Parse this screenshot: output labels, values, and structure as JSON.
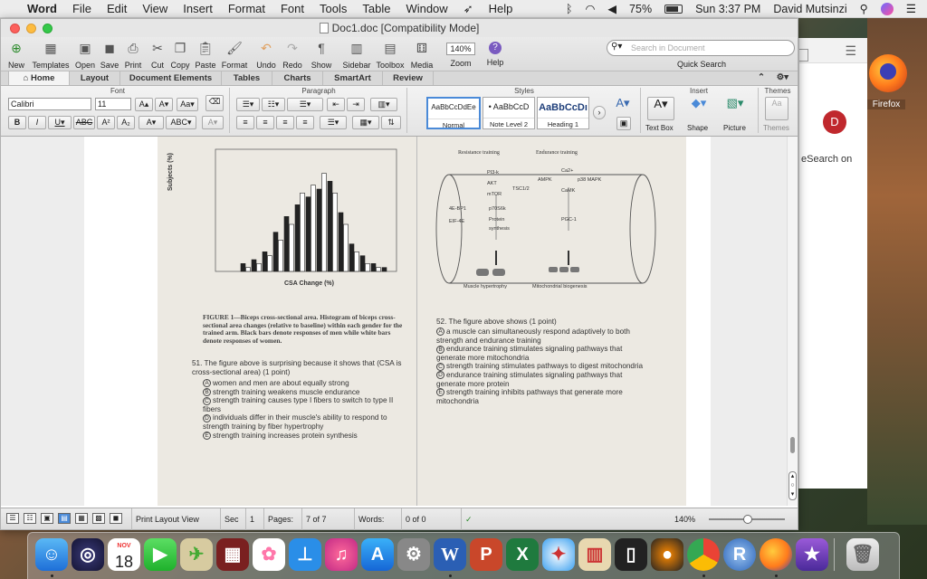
{
  "menubar": {
    "app": "Word",
    "items": [
      "File",
      "Edit",
      "View",
      "Insert",
      "Format",
      "Font",
      "Tools",
      "Table",
      "Window",
      "Help"
    ],
    "battery": "75%",
    "clock": "Sun 3:37 PM",
    "user": "David Mutsinzi"
  },
  "window": {
    "title": "Doc1.doc [Compatibility Mode]"
  },
  "toolbar": {
    "new": "New",
    "templates": "Templates",
    "open": "Open",
    "save": "Save",
    "print": "Print",
    "cut": "Cut",
    "copy": "Copy",
    "paste": "Paste",
    "format": "Format",
    "undo": "Undo",
    "redo": "Redo",
    "show": "Show",
    "sidebar": "Sidebar",
    "toolbox": "Toolbox",
    "media": "Media",
    "zoom_value": "140%",
    "zoom": "Zoom",
    "help": "Help",
    "search_placeholder": "Search in Document",
    "quick_search": "Quick Search"
  },
  "tabs": [
    "Home",
    "Layout",
    "Document Elements",
    "Tables",
    "Charts",
    "SmartArt",
    "Review"
  ],
  "ribbon": {
    "groups": {
      "font": "Font",
      "paragraph": "Paragraph",
      "styles": "Styles",
      "insert": "Insert",
      "themes": "Themes"
    },
    "font_name": "Calibri",
    "font_size": "11",
    "styles": [
      {
        "sample": "AaBbCcDdEe",
        "name": "Normal"
      },
      {
        "sample": "• AaBbCcD",
        "name": "Note Level 2"
      },
      {
        "sample": "AaBbCcDı",
        "name": "Heading 1"
      }
    ],
    "insert": {
      "textbox": "Text Box",
      "shape": "Shape",
      "picture": "Picture",
      "themes": "Themes"
    }
  },
  "document": {
    "chart_header": "CSA Change (%)",
    "figure_caption": "FIGURE 1—Biceps cross-sectional area. Histogram of biceps cross-sectional area changes (relative to baseline) within each gender for the trained arm. Black bars denote responses of men while white bars denote responses of women.",
    "y_axis": "Subjects (%)",
    "q51": {
      "stem": "51. The figure above is surprising because it shows that (CSA is cross-sectional area) (1 point)",
      "options": [
        {
          "letter": "A",
          "text": "women and men are about equally strong"
        },
        {
          "letter": "B",
          "text": "strength training weakens muscle endurance"
        },
        {
          "letter": "C",
          "text": "strength training causes type I fibers to switch to type II fibers"
        },
        {
          "letter": "D",
          "text": "individuals differ in their muscle's ability to respond to strength training by fiber hypertrophy"
        },
        {
          "letter": "E",
          "text": "strength training increases protein synthesis"
        }
      ]
    },
    "q52": {
      "stem": "52. The figure above shows (1 point)",
      "options": [
        {
          "letter": "A",
          "text": "a muscle can simultaneously respond adaptively to both strength and endurance training"
        },
        {
          "letter": "B",
          "text": "endurance training stimulates signaling pathways that generate more mitochondria"
        },
        {
          "letter": "C",
          "text": "strength training stimulates pathways to digest mitochondria"
        },
        {
          "letter": "D",
          "text": "endurance training stimulates signaling pathways that generate more protein"
        },
        {
          "letter": "E",
          "text": "strength training inhibits pathways that generate more mitochondria"
        }
      ]
    },
    "diagram": {
      "resistance": "Resistance training",
      "endurance": "Endurance training",
      "nodes": [
        "PI3-k",
        "AKT",
        "mTOR",
        "TSC1/2",
        "4E-BP1",
        "p70S6k",
        "EIF-4E",
        "Protein synthesis",
        "Ca2+",
        "AMPK",
        "p38 MAPK",
        "CaMK",
        "PGC-1"
      ],
      "hypertrophy": "Muscle hypertrophy",
      "biogenesis": "Mitochondrial biogenesis"
    }
  },
  "chart_data": {
    "type": "bar",
    "xlabel": "CSA Change (%)",
    "ylabel": "Subjects (%)",
    "series": [
      {
        "values": [
          0,
          0,
          2,
          3,
          5,
          10,
          14,
          17,
          19,
          21,
          23,
          15,
          7,
          4,
          2,
          1
        ]
      },
      {
        "values": [
          0,
          0,
          1,
          2,
          4,
          8,
          12,
          20,
          22,
          25,
          20,
          12,
          5,
          2,
          1,
          0
        ]
      }
    ]
  },
  "status": {
    "view": "Print Layout View",
    "sec_label": "Sec",
    "sec": "1",
    "pages_label": "Pages:",
    "pages": "7 of 7",
    "words_label": "Words:",
    "words": "0 of 0",
    "zoom": "140%"
  },
  "behind": {
    "avatar": "D",
    "search": "eSearch on",
    "firefox_label": "Firefox"
  },
  "dock": {
    "calendar_month": "NOV",
    "calendar_day": "18"
  }
}
